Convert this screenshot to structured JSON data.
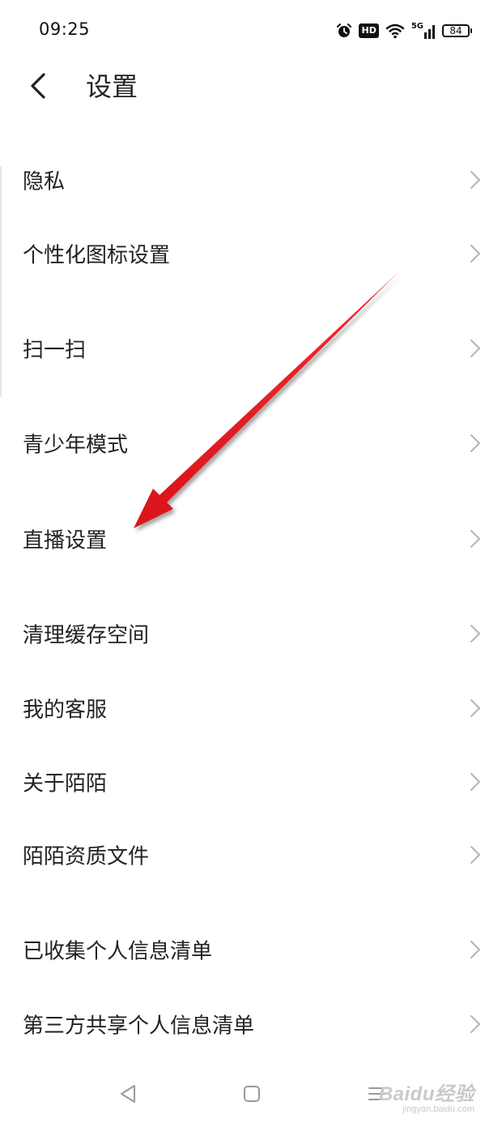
{
  "status_bar": {
    "time": "09:25",
    "hd_label": "HD",
    "network_label": "5G",
    "battery_level": "84"
  },
  "header": {
    "title": "设置"
  },
  "settings": {
    "items": [
      {
        "label": "隐私"
      },
      {
        "label": "个性化图标设置"
      },
      {
        "label": "扫一扫"
      },
      {
        "label": "青少年模式"
      },
      {
        "label": "直播设置"
      },
      {
        "label": "清理缓存空间"
      },
      {
        "label": "我的客服"
      },
      {
        "label": "关于陌陌"
      },
      {
        "label": "陌陌资质文件"
      },
      {
        "label": "已收集个人信息清单"
      },
      {
        "label": "第三方共享个人信息清单"
      }
    ]
  },
  "annotation": {
    "color": "#e8141b",
    "points_to": "直播设置"
  },
  "watermark": {
    "main": "Baidu经验",
    "sub": "jingyan.baidu.com"
  },
  "icons": {
    "back": "chevron-left-icon",
    "item_arrow": "chevron-right-icon",
    "alarm": "alarm-clock-icon",
    "wifi": "wifi-icon",
    "signal": "signal-bars-icon",
    "battery": "battery-icon",
    "nav_back": "triangle-back-icon",
    "nav_home": "square-home-icon",
    "nav_menu": "menu-lines-icon"
  }
}
